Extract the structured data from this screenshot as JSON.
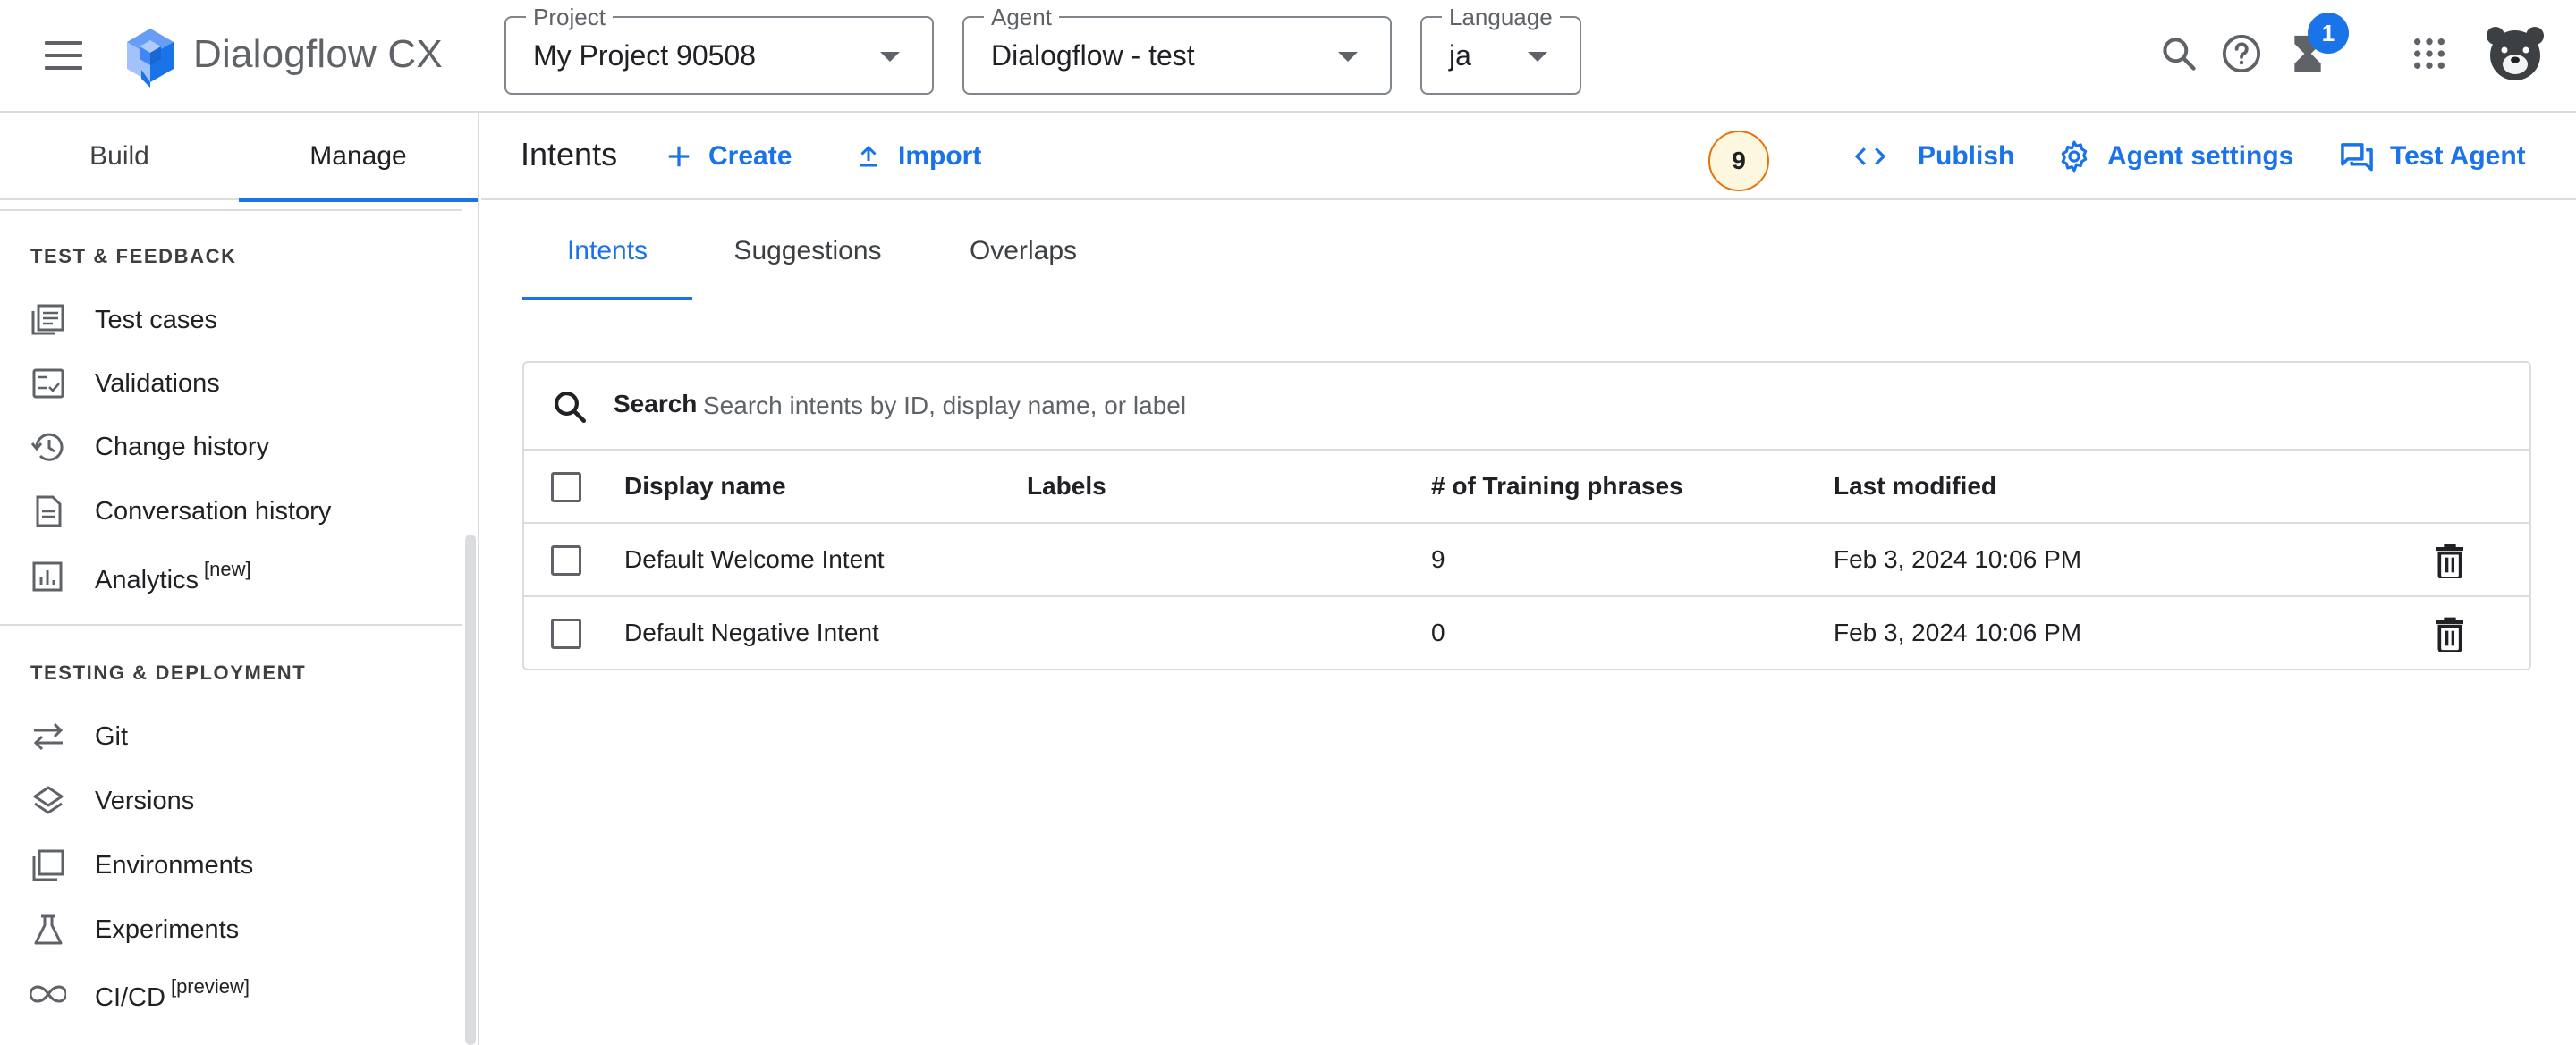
{
  "app": {
    "name": "Dialogflow CX"
  },
  "selectors": {
    "project": {
      "label": "Project",
      "value": "My Project 90508"
    },
    "agent": {
      "label": "Agent",
      "value": "Dialogflow - test"
    },
    "language": {
      "label": "Language",
      "value": "ja"
    }
  },
  "topbar": {
    "notification_count": "1"
  },
  "sidebar": {
    "tabs": [
      {
        "label": "Build"
      },
      {
        "label": "Manage",
        "active": true
      }
    ],
    "sections": [
      {
        "title": "TEST & FEEDBACK",
        "items": [
          {
            "label": "Test cases",
            "icon": "test-cases-icon"
          },
          {
            "label": "Validations",
            "icon": "validations-icon"
          },
          {
            "label": "Change history",
            "icon": "history-icon"
          },
          {
            "label": "Conversation history",
            "icon": "document-icon"
          },
          {
            "label": "Analytics",
            "badge": "[new]",
            "icon": "analytics-icon"
          }
        ]
      },
      {
        "title": "TESTING & DEPLOYMENT",
        "items": [
          {
            "label": "Git",
            "icon": "swap-arrows-icon"
          },
          {
            "label": "Versions",
            "icon": "layers-icon"
          },
          {
            "label": "Environments",
            "icon": "environments-icon"
          },
          {
            "label": "Experiments",
            "icon": "flask-icon"
          },
          {
            "label": "CI/CD",
            "badge": "[preview]",
            "icon": "infinity-icon"
          }
        ]
      }
    ]
  },
  "header": {
    "title": "Intents",
    "create_label": "Create",
    "import_label": "Import",
    "counter": "9",
    "publish_label": "Publish",
    "agent_settings_label": "Agent settings",
    "test_agent_label": "Test Agent"
  },
  "content_tabs": [
    {
      "label": "Intents",
      "active": true
    },
    {
      "label": "Suggestions"
    },
    {
      "label": "Overlaps"
    }
  ],
  "table": {
    "search_label": "Search",
    "search_placeholder": "Search intents by ID, display name, or label",
    "columns": [
      "Display name",
      "Labels",
      "# of Training phrases",
      "Last modified"
    ],
    "rows": [
      {
        "display_name": "Default Welcome Intent",
        "labels": "",
        "training_phrases": "9",
        "last_modified": "Feb 3, 2024 10:06 PM"
      },
      {
        "display_name": "Default Negative Intent",
        "labels": "",
        "training_phrases": "0",
        "last_modified": "Feb 3, 2024 10:06 PM"
      }
    ]
  },
  "colors": {
    "accent": "#1a73e8",
    "counter_border": "#e8710a",
    "divider": "#dadce0",
    "text": "#202124"
  }
}
